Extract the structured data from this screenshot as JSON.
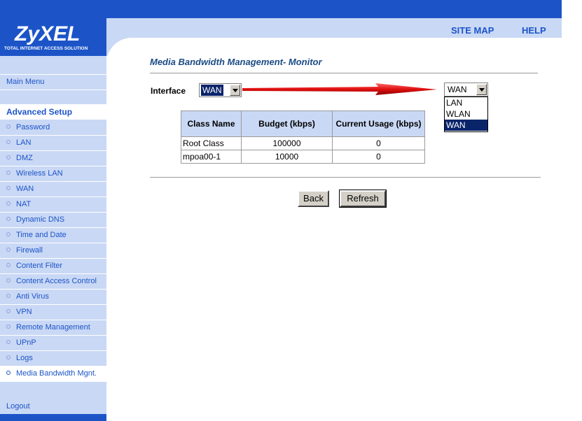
{
  "brand": {
    "name": "ZyXEL",
    "tagline": "Total Internet Access Solution"
  },
  "topnav": {
    "site_map": "SITE MAP",
    "help": "HELP"
  },
  "sidebar": {
    "main_menu": "Main Menu",
    "section": "Advanced Setup",
    "items": [
      {
        "label": "Password"
      },
      {
        "label": "LAN"
      },
      {
        "label": "DMZ"
      },
      {
        "label": "Wireless LAN"
      },
      {
        "label": "WAN"
      },
      {
        "label": "NAT"
      },
      {
        "label": "Dynamic DNS"
      },
      {
        "label": "Time and Date"
      },
      {
        "label": "Firewall"
      },
      {
        "label": "Content Filter"
      },
      {
        "label": "Content Access Control"
      },
      {
        "label": "Anti Virus"
      },
      {
        "label": "VPN"
      },
      {
        "label": "Remote Management"
      },
      {
        "label": "UPnP"
      },
      {
        "label": "Logs"
      },
      {
        "label": "Media Bandwidth Mgnt.",
        "active": true
      }
    ],
    "logout": "Logout"
  },
  "page": {
    "title": "Media Bandwidth Management- Monitor",
    "interface_label": "Interface",
    "interface_value": "WAN",
    "dropdown": {
      "value": "WAN",
      "options": [
        "LAN",
        "WLAN",
        "WAN"
      ],
      "selected": "WAN"
    },
    "table": {
      "headers": [
        "Class Name",
        "Budget (kbps)",
        "Current Usage (kbps)"
      ],
      "rows": [
        [
          "Root Class",
          "100000",
          "0"
        ],
        [
          "mpoa00-1",
          "10000",
          "0"
        ]
      ]
    },
    "buttons": {
      "back": "Back",
      "refresh": "Refresh"
    }
  },
  "colors": {
    "brand_blue": "#1c54c8",
    "nav_light": "#c9d8f5",
    "title": "#1a4b84",
    "arrow": "#e01010"
  }
}
